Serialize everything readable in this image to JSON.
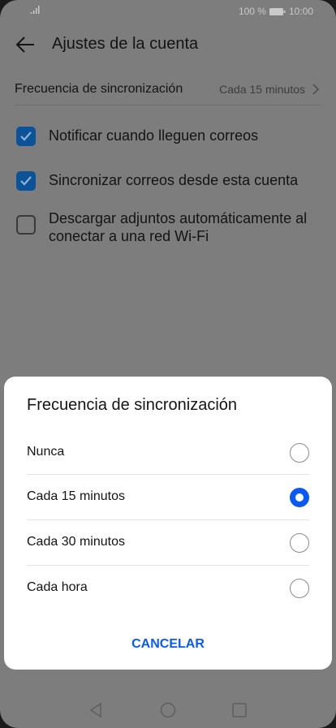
{
  "status_bar": {
    "battery_text": "100 %",
    "time": "10:00"
  },
  "header": {
    "title": "Ajustes de la cuenta"
  },
  "settings": {
    "sync_label": "Frecuencia de sincronización",
    "sync_value": "Cada 15 minutos",
    "checks": [
      {
        "label": "Notificar cuando lleguen correos",
        "checked": true
      },
      {
        "label": "Sincronizar correos desde esta cuenta",
        "checked": true
      },
      {
        "label": "Descargar adjuntos automáticamente al conectar a una red Wi-Fi",
        "checked": false
      }
    ]
  },
  "dialog": {
    "title": "Frecuencia de sincronización",
    "options": [
      {
        "label": "Nunca",
        "selected": false
      },
      {
        "label": "Cada 15 minutos",
        "selected": true
      },
      {
        "label": "Cada 30 minutos",
        "selected": false
      },
      {
        "label": "Cada hora",
        "selected": false
      }
    ],
    "cancel_label": "CANCELAR"
  },
  "colors": {
    "accent": "#0a59f7",
    "checkbox": "#0c5296",
    "overlay": "#7d7d7d"
  },
  "nav_bar": {
    "icons": [
      "back-triangle-icon",
      "home-circle-icon",
      "recents-square-icon"
    ]
  }
}
